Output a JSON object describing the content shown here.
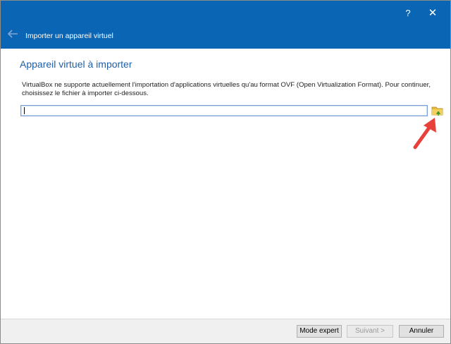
{
  "titlebar": {
    "help_label": "?",
    "close_label": "✕",
    "background": "#0a65b5"
  },
  "wizard": {
    "title": "Importer un appareil virtuel",
    "back_icon": "back-arrow-icon"
  },
  "page": {
    "title": "Appareil virtuel à importer",
    "description": "VirtualBox ne supporte actuellement l'importation d'applications virtuelles qu'au format OVF (Open Virtualization Format). Pour continuer, choisissez le fichier à importer ci-dessous."
  },
  "file_chooser": {
    "value": "",
    "browse_icon": "folder-browse-icon",
    "annotation_icon": "red-arrow-icon",
    "annotation_color": "#e8413a"
  },
  "footer": {
    "expert_label": "Mode expert",
    "next_label": "Suivant >",
    "cancel_label": "Annuler",
    "next_enabled": false
  }
}
